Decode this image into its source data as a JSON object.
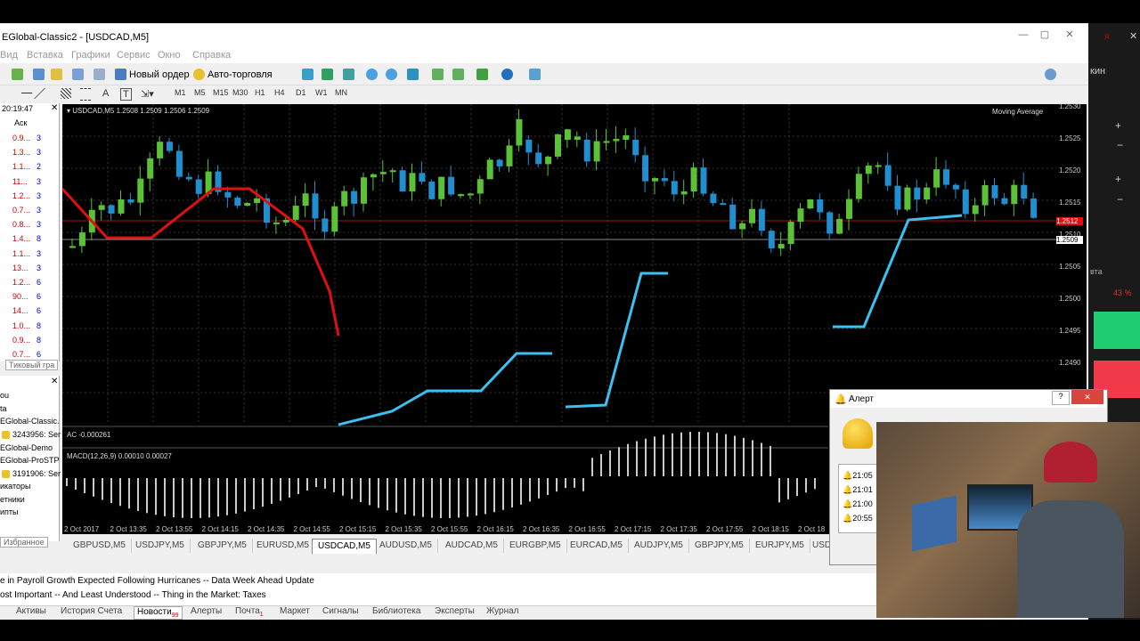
{
  "window": {
    "title": "EGlobal-Classic2 - [USDCAD,M5]",
    "min_label": "—",
    "max_label": "▢",
    "close_label": "✕"
  },
  "menu": [
    "Вид",
    "Вставка",
    "Графики",
    "Сервис",
    "Окно",
    "Справка"
  ],
  "toolbar": {
    "new_order": "Новый ордер",
    "auto_trading": "Авто-торговля"
  },
  "timeframes": [
    "M1",
    "M5",
    "M15",
    "M30",
    "H1",
    "H4",
    "D1",
    "W1",
    "MN"
  ],
  "market_watch": {
    "time": "20:19:47",
    "ask_header": "Аск",
    "rows": [
      {
        "ask": "0.9...",
        "spread": "3"
      },
      {
        "ask": "1.3...",
        "spread": "3"
      },
      {
        "ask": "1.1...",
        "spread": "2"
      },
      {
        "ask": "11...",
        "spread": "3"
      },
      {
        "ask": "1.2...",
        "spread": "3"
      },
      {
        "ask": "0.7...",
        "spread": "3"
      },
      {
        "ask": "0.8...",
        "spread": "3"
      },
      {
        "ask": "1.4...",
        "spread": "8"
      },
      {
        "ask": "1.1...",
        "spread": "3"
      },
      {
        "ask": "13...",
        "spread": "3"
      },
      {
        "ask": "1.2...",
        "spread": "6"
      },
      {
        "ask": "90...",
        "spread": "6"
      },
      {
        "ask": "14...",
        "spread": "6"
      },
      {
        "ask": "1.0...",
        "spread": "8"
      },
      {
        "ask": "0.9...",
        "spread": "8"
      },
      {
        "ask": "0.7...",
        "spread": "6"
      }
    ],
    "tick_tab": "Тиковый гра"
  },
  "navigator": {
    "items": [
      "ou",
      "ta",
      "EGlobal-Classic.",
      "3243956: Ser",
      "EGlobal-Demo",
      "EGlobal-ProSTP",
      "3191906: Ser",
      "икаторы",
      "етники",
      "ипты"
    ],
    "tab": "Избранное"
  },
  "chart": {
    "header": "USDCAD,M5  1.2508 1.2509 1.2506 1.2509",
    "indicator": "Moving Average",
    "ac_label": "AC -0.000261",
    "macd_label": "MACD(12,26,9) 0.00010 0.00027",
    "price_labels": [
      "1.2530",
      "1.2525",
      "1.2520",
      "1.2515",
      "1.2510",
      "1.2505",
      "1.2500",
      "1.2495",
      "1.2490"
    ],
    "current_price_red": "1.2512",
    "current_price": "1.2509",
    "time_labels": [
      "2 Oct 2017",
      "2 Oct 13:35",
      "2 Oct 13:55",
      "2 Oct 14:15",
      "2 Oct 14:35",
      "2 Oct 14:55",
      "2 Oct 15:15",
      "2 Oct 15:35",
      "2 Oct 15:55",
      "2 Oct 16:15",
      "2 Oct 16:35",
      "2 Oct 16:55",
      "2 Oct 17:15",
      "2 Oct 17:35",
      "2 Oct 17:55",
      "2 Oct 18:15",
      "2 Oct 18"
    ]
  },
  "symbol_tabs": [
    "GBPUSD,M5",
    "USDJPY,M5",
    "GBPJPY,M5",
    "EURUSD,M5",
    "USDCAD,M5",
    "AUDUSD,M5",
    "AUDCAD,M5",
    "EURGBP,M5",
    "EURCAD,M5",
    "AUDJPY,M5",
    "GBPJPY,M5",
    "EURJPY,M5",
    "USD"
  ],
  "news": [
    "e in Payroll Growth Expected Following Hurricanes -- Data Week Ahead Update",
    "ost Important -- And Least Understood -- Thing in the Market: Taxes"
  ],
  "bottom_tabs": [
    {
      "label": "Активы"
    },
    {
      "label": "История Счета"
    },
    {
      "label": "Новости",
      "badge": "99"
    },
    {
      "label": "Алерты"
    },
    {
      "label": "Почта",
      "badge": "1"
    },
    {
      "label": "Маркет"
    },
    {
      "label": "Сигналы"
    },
    {
      "label": "Библиотека"
    },
    {
      "label": "Эксперты"
    },
    {
      "label": "Журнал"
    }
  ],
  "alert": {
    "title": "Алерт",
    "help": "?",
    "close": "✕",
    "times": [
      "21:05",
      "21:01",
      "21:00",
      "20:55"
    ]
  },
  "right_panel": {
    "label_top": "кин",
    "label_mid": "вта",
    "percent": "43 %",
    "plus": "+",
    "minus": "−"
  },
  "colors": {
    "bull": "#5bc236",
    "bear": "#1f8fcf",
    "red_line": "#e01010",
    "blue_line": "#3cc0f0"
  }
}
